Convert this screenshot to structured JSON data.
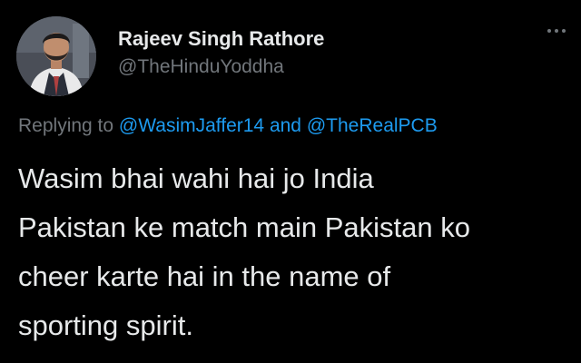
{
  "tweet": {
    "author_name": "Rajeev Singh Rathore",
    "author_handle": "@TheHinduYoddha",
    "avatar_icon": "user-avatar-photo",
    "more_icon": "more-options-icon",
    "replying_prefix": "Replying to",
    "reply_mention_1": "@WasimJaffer14",
    "reply_and": "and",
    "reply_mention_2": "@TheRealPCB",
    "text_lines": [
      "Wasim bhai wahi hai jo India",
      "Pakistan ke match main Pakistan ko",
      "cheer karte hai in the name of",
      "sporting spirit."
    ]
  },
  "colors": {
    "background": "#000000",
    "primary_text": "#e7e9ea",
    "secondary_text": "#71767b",
    "link": "#1d9bf0"
  }
}
